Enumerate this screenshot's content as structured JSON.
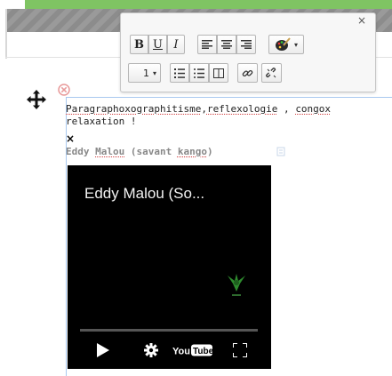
{
  "toolbar": {
    "close_label": "×",
    "bold_label": "B",
    "underline_label": "U",
    "italic_label": "I",
    "font_size_label": "1",
    "caret": "▾",
    "icons": [
      "align-left-icon",
      "align-center-icon",
      "align-right-icon",
      "palette-icon",
      "ordered-list-icon",
      "unordered-list-icon",
      "table-icon",
      "link-icon",
      "unlink-icon"
    ]
  },
  "content": {
    "paragraph_line1_pre": "Paragraphoxographitisme",
    "paragraph_line1_mid": ",",
    "paragraph_line1_word2": "reflexologie",
    "paragraph_line1_sep": " , ",
    "paragraph_line1_word3": "congox",
    "paragraph_line2": "relaxation !",
    "x_mark": "×",
    "video_title_pre": "Eddy ",
    "video_title_word1": "Malou",
    "video_title_mid": " (savant ",
    "video_title_word2": "kango",
    "video_title_post": ")"
  },
  "video": {
    "title": "Eddy Malou (So...",
    "youtube_label": "YouTube",
    "progress": 0,
    "colors": {
      "background": "#000000",
      "title": "#f2f2f2",
      "logo_green": "#2e8b2e"
    }
  },
  "colors": {
    "green_bar": "#7fc463",
    "frame_border": "#a8c8ef",
    "remove_icon": "#e89a9a"
  }
}
